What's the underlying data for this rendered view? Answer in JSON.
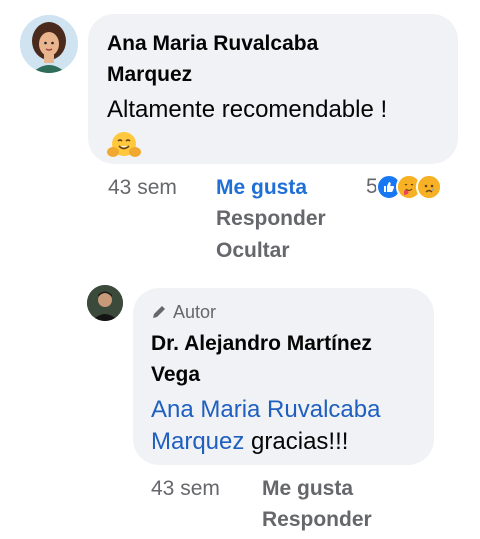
{
  "comment": {
    "author": "Ana Maria Ruvalcaba",
    "author_line2": "Marquez",
    "text": "Altamente recomendable !",
    "time": "43 sem",
    "like_label": "Me gusta",
    "reply_label": "Responder",
    "hide_label": "Ocultar",
    "reaction_count": "5",
    "reaction_icons": [
      "like-icon",
      "care-icon",
      "sad-icon"
    ],
    "emoji_icon": "hugging-face-emoji-icon"
  },
  "reply": {
    "badge": "Autor",
    "badge_icon": "pencil-icon",
    "author": "Dr. Alejandro Martínez",
    "author_line2": "Vega",
    "mention_line1": "Ana Maria Ruvalcaba",
    "mention_line2": "Marquez",
    "text": " gracias!!!",
    "time": "43 sem",
    "like_label": "Me gusta",
    "reply_label": "Responder"
  },
  "colors": {
    "bubble": "#f0f2f5",
    "link": "#1f6fd6",
    "meta": "#65676b"
  }
}
